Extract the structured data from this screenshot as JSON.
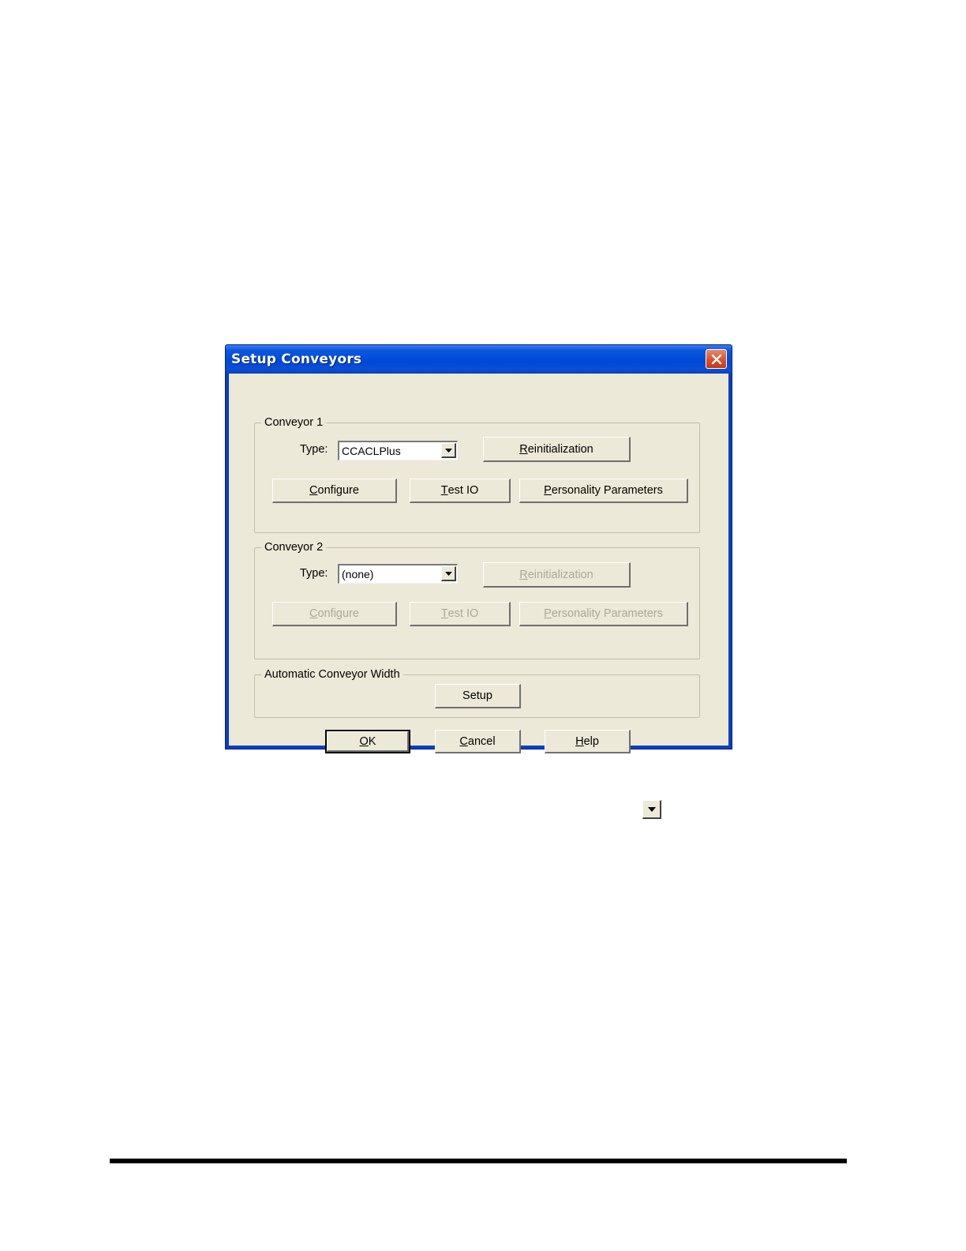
{
  "dialog": {
    "title": "Setup Conveyors",
    "conveyor1": {
      "group_label": "Conveyor 1",
      "type_label": "Type:",
      "type_value": "CCACLPlus",
      "reinit": {
        "accel": "R",
        "rest": "einitialization"
      },
      "configure": {
        "accel": "C",
        "rest": "onfigure"
      },
      "test_io": {
        "accel": "T",
        "rest": "est IO"
      },
      "personality": {
        "accel": "P",
        "rest": "ersonality Parameters"
      }
    },
    "conveyor2": {
      "group_label": "Conveyor 2",
      "type_label": "Type:",
      "type_value": "(none)",
      "reinit": {
        "accel": "R",
        "rest": "einitialization"
      },
      "configure": {
        "accel": "C",
        "rest": "onfigure"
      },
      "test_io": {
        "accel": "T",
        "rest": "est IO"
      },
      "personality": {
        "accel": "P",
        "rest": "ersonality Parameters"
      }
    },
    "auto_width": {
      "group_label": "Automatic Conveyor Width",
      "setup_label": "Setup"
    },
    "ok": {
      "accel": "O",
      "rest": "K"
    },
    "cancel": {
      "accel": "C",
      "rest": "ancel"
    },
    "help": {
      "accel": "H",
      "rest": "elp"
    }
  },
  "icons": {
    "close": "close-icon",
    "dropdown": "chevron-down-icon"
  },
  "colors": {
    "titlebar": "#0048d8",
    "dialog_face": "#ece9d8",
    "disabled_text": "#aca899",
    "close_button": "#d9532c"
  }
}
